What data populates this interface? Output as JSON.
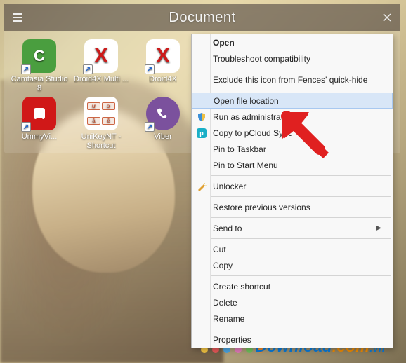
{
  "window": {
    "title": "Document"
  },
  "icons": [
    {
      "name": "camtasia",
      "label": "Camtasia Studio 8"
    },
    {
      "name": "droid4x-1",
      "label": "Droid4X Multi ..."
    },
    {
      "name": "droid4x-2",
      "label": "Droid4X"
    },
    {
      "name": "formatfact",
      "label": ""
    },
    {
      "name": "idm",
      "label": ""
    },
    {
      "name": "skype",
      "label": ""
    },
    {
      "name": "ummy",
      "label": "UmmyVi..."
    },
    {
      "name": "unikey",
      "label": "UniKeyNT - Shortcut"
    },
    {
      "name": "viber",
      "label": "Viber"
    }
  ],
  "context_menu": {
    "open": "Open",
    "troubleshoot": "Troubleshoot compatibility",
    "exclude_fences": "Exclude this icon from Fences' quick-hide",
    "open_location": "Open file location",
    "run_admin": "Run as administrator",
    "pcloud": "Copy to pCloud Sync",
    "pin_taskbar": "Pin to Taskbar",
    "pin_start": "Pin to Start Menu",
    "unlocker": "Unlocker",
    "restore": "Restore previous versions",
    "send_to": "Send to",
    "cut": "Cut",
    "copy": "Copy",
    "create_shortcut": "Create shortcut",
    "delete": "Delete",
    "rename": "Rename",
    "properties": "Properties"
  },
  "watermark": {
    "part1": "Download",
    "part2": ".com",
    "part3": ".vn"
  },
  "dot_colors": [
    "#f4c542",
    "#e85858",
    "#4aa3e0",
    "#e07ab8",
    "#6fbf5a",
    "#f08a2a"
  ]
}
